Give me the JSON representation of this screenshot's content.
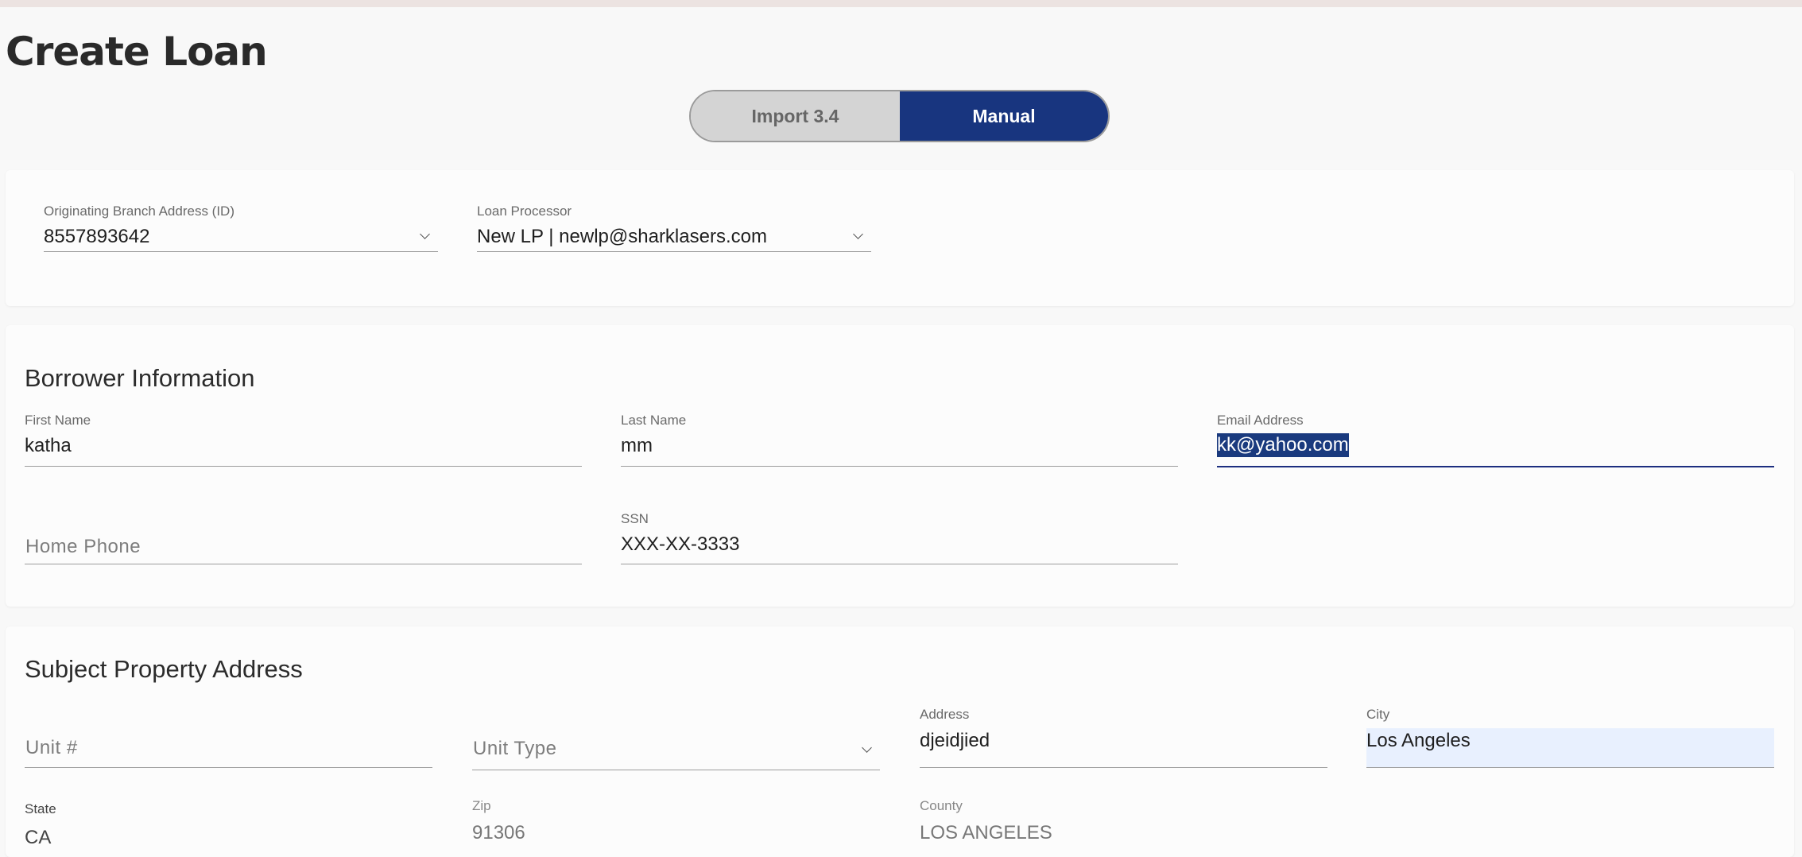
{
  "page": {
    "title": "Create Loan"
  },
  "mode_toggle": {
    "import_label": "Import 3.4",
    "manual_label": "Manual",
    "selected": "Manual"
  },
  "origination": {
    "branch": {
      "label": "Originating Branch Address (ID)",
      "value": "8557893642"
    },
    "processor": {
      "label": "Loan Processor",
      "value": "New LP | newlp@sharklasers.com"
    }
  },
  "borrower": {
    "title": "Borrower Information",
    "first_name": {
      "label": "First Name",
      "value": "katha"
    },
    "last_name": {
      "label": "Last Name",
      "value": "mm"
    },
    "email": {
      "label": "Email Address",
      "value": "kk@yahoo.com"
    },
    "home_phone": {
      "placeholder": "Home Phone"
    },
    "ssn": {
      "label": "SSN",
      "value": "XXX-XX-3333"
    }
  },
  "property": {
    "title": "Subject Property Address",
    "unit_number": {
      "placeholder": "Unit #"
    },
    "unit_type": {
      "placeholder": "Unit Type"
    },
    "address": {
      "label": "Address",
      "value": "djeidjied"
    },
    "city": {
      "label": "City",
      "value": "Los Angeles"
    },
    "state": {
      "label": "State",
      "value": "CA"
    },
    "zip": {
      "label": "Zip",
      "value": "91306"
    },
    "county": {
      "label": "County",
      "value": "LOS ANGELES"
    }
  },
  "colors": {
    "primary": "#18357f",
    "toggle_inactive": "#d4d4d4",
    "background": "#f8f8f8",
    "top_strip": "#ece3e1",
    "autofill": "#e8f0fe"
  }
}
